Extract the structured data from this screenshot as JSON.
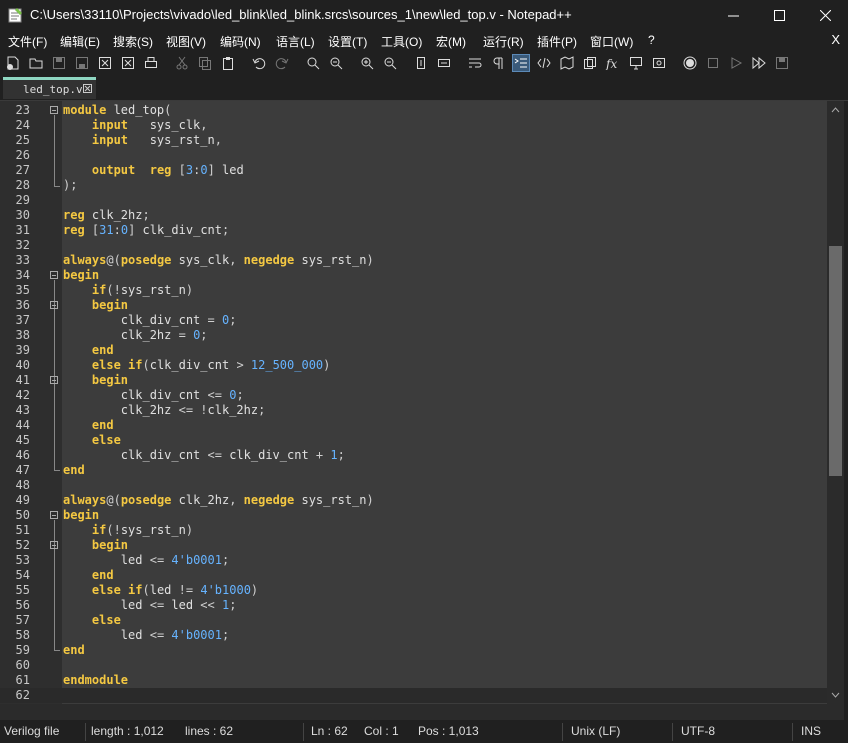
{
  "window": {
    "title": "C:\\Users\\33110\\Projects\\vivado\\led_blink\\led_blink.srcs\\sources_1\\new\\led_top.v - Notepad++"
  },
  "menu": [
    "文件(F)",
    "编辑(E)",
    "搜索(S)",
    "视图(V)",
    "编码(N)",
    "语言(L)",
    "设置(T)",
    "工具(O)",
    "宏(M)",
    "运行(R)",
    "插件(P)",
    "窗口(W)",
    "?"
  ],
  "menu_close": "X",
  "tab": {
    "label": "led_top.v"
  },
  "code": [
    {
      "n": "23",
      "t": "module led_top("
    },
    {
      "n": "24",
      "t": "    input   sys_clk,"
    },
    {
      "n": "25",
      "t": "    input   sys_rst_n,"
    },
    {
      "n": "26",
      "t": ""
    },
    {
      "n": "27",
      "t": "    output  reg [3:0] led"
    },
    {
      "n": "28",
      "t": ");"
    },
    {
      "n": "29",
      "t": ""
    },
    {
      "n": "30",
      "t": "reg clk_2hz;"
    },
    {
      "n": "31",
      "t": "reg [31:0] clk_div_cnt;"
    },
    {
      "n": "32",
      "t": ""
    },
    {
      "n": "33",
      "t": "always@(posedge sys_clk, negedge sys_rst_n)"
    },
    {
      "n": "34",
      "t": "begin"
    },
    {
      "n": "35",
      "t": "    if(!sys_rst_n)"
    },
    {
      "n": "36",
      "t": "    begin"
    },
    {
      "n": "37",
      "t": "        clk_div_cnt = 0;"
    },
    {
      "n": "38",
      "t": "        clk_2hz = 0;"
    },
    {
      "n": "39",
      "t": "    end"
    },
    {
      "n": "40",
      "t": "    else if(clk_div_cnt > 12_500_000)"
    },
    {
      "n": "41",
      "t": "    begin"
    },
    {
      "n": "42",
      "t": "        clk_div_cnt <= 0;"
    },
    {
      "n": "43",
      "t": "        clk_2hz <= !clk_2hz;"
    },
    {
      "n": "44",
      "t": "    end"
    },
    {
      "n": "45",
      "t": "    else"
    },
    {
      "n": "46",
      "t": "        clk_div_cnt <= clk_div_cnt + 1;"
    },
    {
      "n": "47",
      "t": "end"
    },
    {
      "n": "48",
      "t": ""
    },
    {
      "n": "49",
      "t": "always@(posedge clk_2hz, negedge sys_rst_n)"
    },
    {
      "n": "50",
      "t": "begin"
    },
    {
      "n": "51",
      "t": "    if(!sys_rst_n)"
    },
    {
      "n": "52",
      "t": "    begin"
    },
    {
      "n": "53",
      "t": "        led <= 4'b0001;"
    },
    {
      "n": "54",
      "t": "    end"
    },
    {
      "n": "55",
      "t": "    else if(led != 4'b1000)"
    },
    {
      "n": "56",
      "t": "        led <= led << 1;"
    },
    {
      "n": "57",
      "t": "    else"
    },
    {
      "n": "58",
      "t": "        led <= 4'b0001;"
    },
    {
      "n": "59",
      "t": "end"
    },
    {
      "n": "60",
      "t": ""
    },
    {
      "n": "61",
      "t": "endmodule"
    },
    {
      "n": "62",
      "t": ""
    }
  ],
  "status": {
    "filetype": "Verilog file",
    "length": "length : 1,012",
    "lines": "lines : 62",
    "ln": "Ln : 62",
    "col": "Col : 1",
    "pos": "Pos : 1,013",
    "eol": "Unix (LF)",
    "encoding": "UTF-8",
    "mode": "INS"
  },
  "colors": {
    "keyword": "#f4c842",
    "number": "#66b3ff",
    "text": "#e0e0e0",
    "background": "#3c3c3c",
    "tab_accent": "#8fd7c2"
  }
}
